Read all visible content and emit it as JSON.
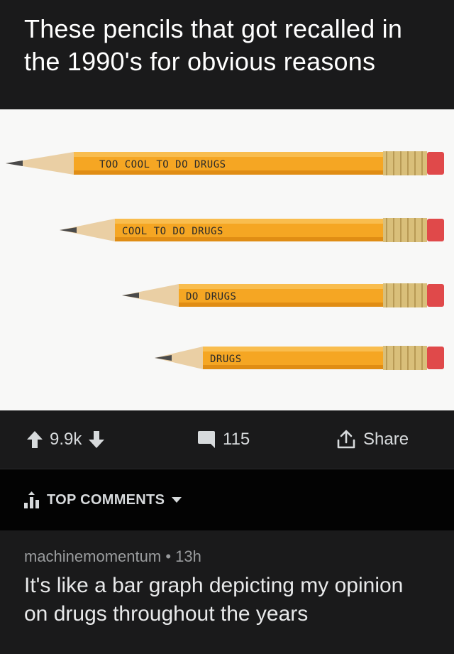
{
  "post": {
    "title": "These pencils that got recalled in the 1990's for obvious reasons",
    "image": {
      "pencil_labels": [
        "TOO COOL TO DO DRUGS",
        "COOL TO DO DRUGS",
        "DO DRUGS",
        "DRUGS"
      ],
      "colors": {
        "background": "#f8f8f7",
        "pencil_body": "#f5a623",
        "ferrule": "#d9bf7a",
        "eraser": "#e0494a",
        "wood": "#eacfa4",
        "lead": "#4a4a4a"
      }
    }
  },
  "actions": {
    "upvote_icon": "arrow-up-icon",
    "score": "9.9k",
    "downvote_icon": "arrow-down-icon",
    "comment_icon": "speech-bubble-icon",
    "comment_count": "115",
    "share_icon": "share-icon",
    "share_label": "Share"
  },
  "sort": {
    "icon": "top-bars-icon",
    "label": "TOP COMMENTS",
    "dropdown_icon": "caret-down-icon"
  },
  "comments": [
    {
      "author": "machinemomentum",
      "separator": "•",
      "age": "13h",
      "body": "It's like a bar graph depicting my opinion on drugs throughout the years"
    }
  ],
  "theme": {
    "background": "#1a1a1b",
    "sort_bar_background": "#030303",
    "text": "#d7dadc",
    "meta_text": "#9a9c9e"
  }
}
